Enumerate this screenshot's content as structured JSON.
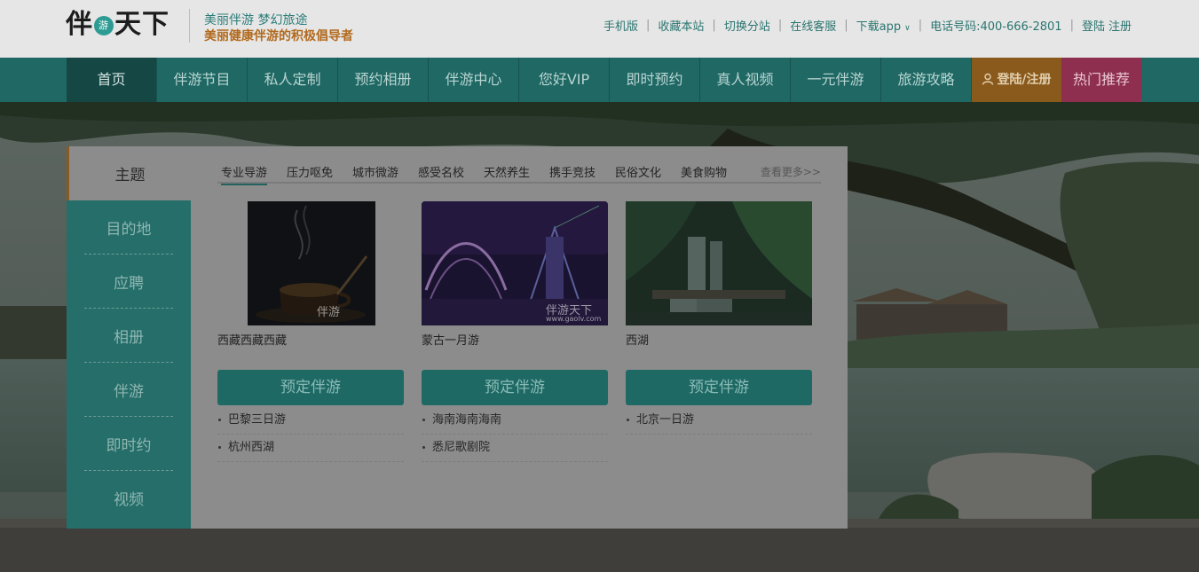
{
  "header": {
    "logo": {
      "char1": "伴",
      "badge": "游",
      "chars2": "天下"
    },
    "slogan_line1": "美丽伴游 梦幻旅途",
    "slogan_line2": "美丽健康伴游的积极倡导者",
    "top_links": {
      "mobile": "手机版",
      "bookmark": "收藏本站",
      "switch_site": "切换分站",
      "online_service": "在线客服",
      "download_app": "下载app",
      "phone": "电话号码:400-666-2801",
      "login": "登陆",
      "register": "注册"
    }
  },
  "nav": {
    "items": [
      "首页",
      "伴游节目",
      "私人定制",
      "预约相册",
      "伴游中心",
      "您好VIP",
      "即时预约",
      "真人视频",
      "一元伴游",
      "旅游攻略"
    ],
    "login_register": "登陆/注册",
    "hot": "热门推荐"
  },
  "panel": {
    "side_title": "主题",
    "side_items": [
      "目的地",
      "应聘",
      "相册",
      "伴游",
      "即时约",
      "视频"
    ],
    "tabs": [
      "专业导游",
      "压力呕免",
      "城市微游",
      "感受名校",
      "天然养生",
      "携手竞技",
      "民俗文化",
      "美食购物"
    ],
    "more": "查看更多>>",
    "cards": [
      {
        "title": "西藏西藏西藏",
        "button": "预定伴游",
        "watermark": "伴游",
        "items": [
          "巴黎三日游",
          "杭州西湖"
        ]
      },
      {
        "title": "蒙古一月游",
        "button": "预定伴游",
        "watermark": "伴游天下",
        "watermark_url": "www.gaolv.com",
        "items": [
          "海南海南海南",
          "悉尼歌剧院"
        ]
      },
      {
        "title": "西湖",
        "button": "预定伴游",
        "items": [
          "北京一日游"
        ]
      }
    ]
  },
  "colors": {
    "teal": "#2d9b93",
    "nav_login_orange": "#e6a23c",
    "nav_hot_pink": "#e34e82",
    "slogan_orange": "#f08b1c"
  }
}
